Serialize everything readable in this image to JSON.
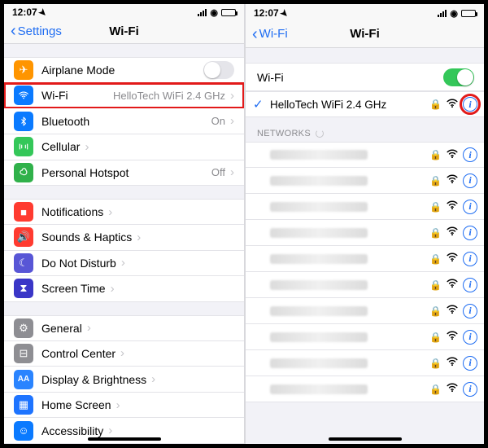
{
  "status": {
    "time": "12:07"
  },
  "left": {
    "back": "Settings",
    "title": "Wi-Fi",
    "rows": {
      "airplane": "Airplane Mode",
      "wifi": "Wi-Fi",
      "wifi_val": "HelloTech WiFi 2.4 GHz",
      "bluetooth": "Bluetooth",
      "bluetooth_val": "On",
      "cellular": "Cellular",
      "hotspot": "Personal Hotspot",
      "hotspot_val": "Off",
      "notifications": "Notifications",
      "sounds": "Sounds & Haptics",
      "dnd": "Do Not Disturb",
      "screentime": "Screen Time",
      "general": "General",
      "control": "Control Center",
      "display": "Display & Brightness",
      "home": "Home Screen",
      "accessibility": "Accessibility"
    }
  },
  "right": {
    "back": "Wi-Fi",
    "title": "Wi-Fi",
    "wifi_label": "Wi-Fi",
    "connected": "HelloTech WiFi 2.4 GHz",
    "networks_header": "NETWORKS"
  }
}
